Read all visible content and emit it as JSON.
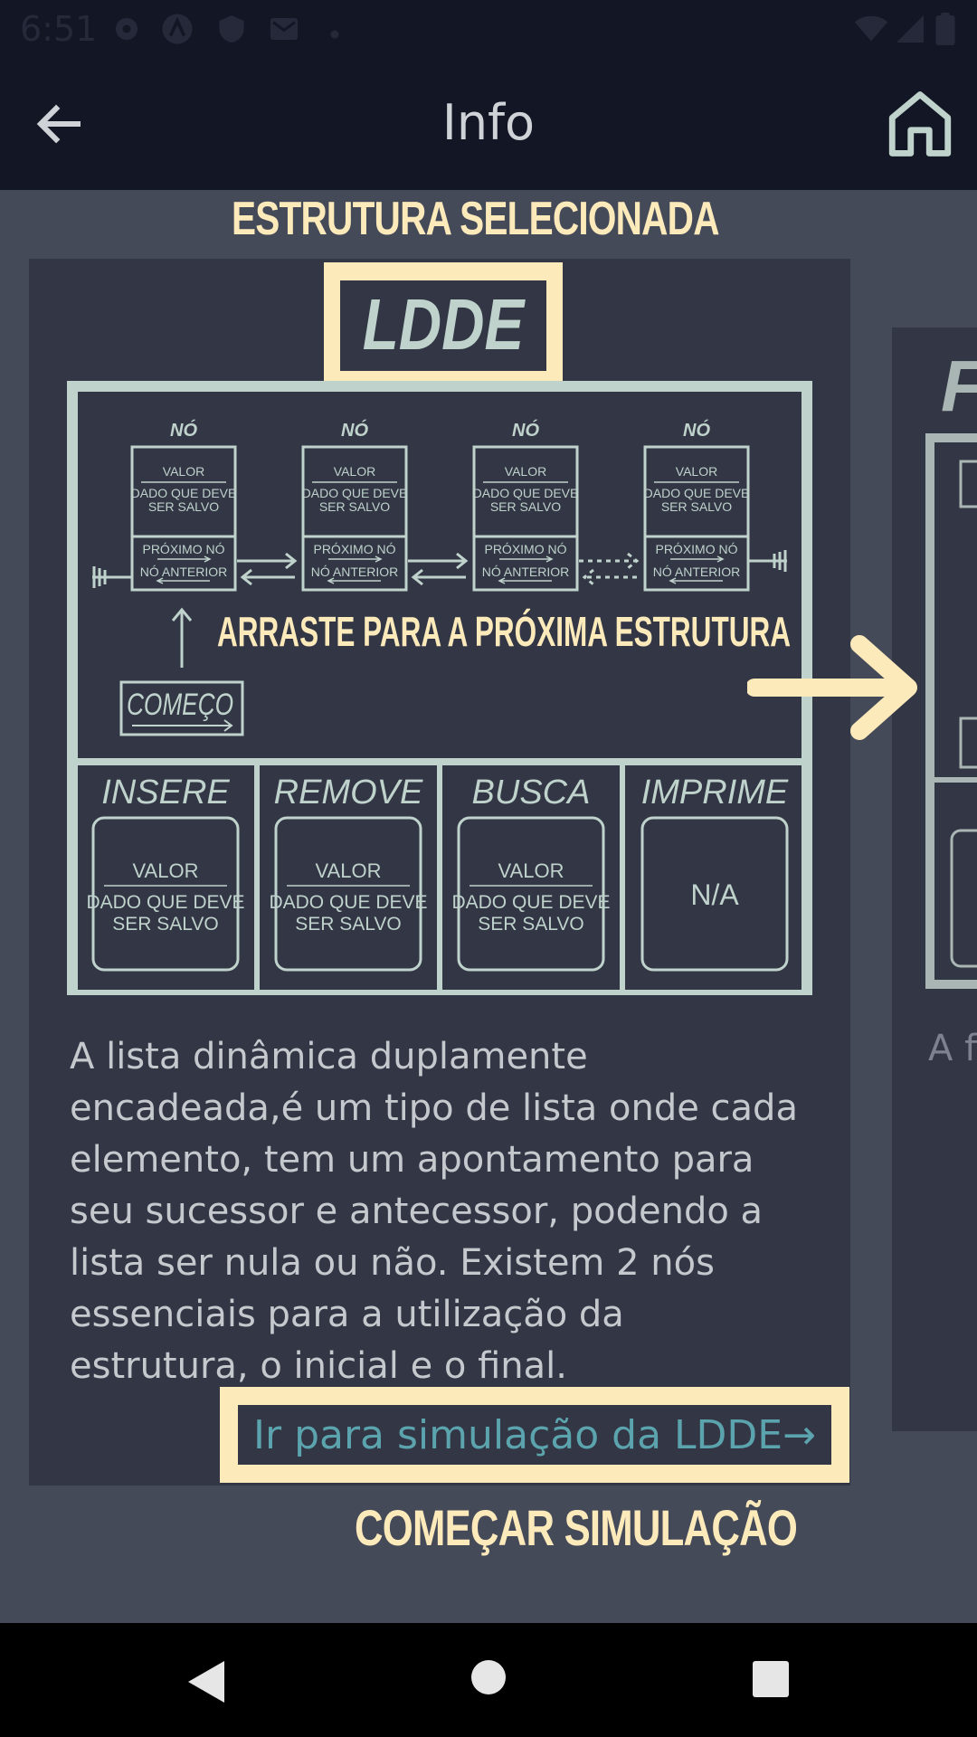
{
  "status_bar": {
    "time": "6:51"
  },
  "app_bar": {
    "title": "Info"
  },
  "selected_caption": "ESTRUTURA SELECIONADA",
  "card": {
    "badge": "LDDE",
    "node_title": "NÓ",
    "node_value_label": "VALOR",
    "node_value_desc_1": "DADO QUE DEVE",
    "node_value_desc_2": "SER SALVO",
    "node_next": "PRÓXIMO NÓ",
    "node_prev": "NÓ ANTERIOR",
    "start_label": "COMEÇO",
    "swipe_hint": "ARRASTE PARA A PRÓXIMA ESTRUTURA",
    "operations": [
      {
        "name": "INSERE",
        "value": "VALOR",
        "desc_1": "DADO QUE DEVE",
        "desc_2": "SER SALVO"
      },
      {
        "name": "REMOVE",
        "value": "VALOR",
        "desc_1": "DADO QUE DEVE",
        "desc_2": "SER SALVO"
      },
      {
        "name": "BUSCA",
        "value": "VALOR",
        "desc_1": "DADO QUE DEVE",
        "desc_2": "SER SALVO"
      },
      {
        "name": "IMPRIME",
        "value": "N/A"
      }
    ],
    "description": "A lista dinâmica duplamente encadeada,é um tipo de lista onde cada elemento, tem um apontamento para seu sucessor e antecessor, podendo a lista ser nula ou não. Existem 2 nós essenciais para a utilização da estrutura, o inicial e o final.",
    "simulation_button": "Ir para simulação da LDDE→"
  },
  "next_card": {
    "badge_partial": "F",
    "description_partial": "A fi line do iníc con"
  },
  "start_simulation_caption": "COMEÇAR SIMULAÇÃO",
  "colors": {
    "accent": "#fceabb",
    "card": "#323645",
    "background": "#454a59",
    "bars": "#131725",
    "link": "#5ba3ad",
    "diagram_line": "#bfd2cb"
  },
  "icons": [
    "gear-icon",
    "a-icon",
    "shield-icon",
    "mail-icon",
    "wifi-icon",
    "signal-icon",
    "battery-icon",
    "back-arrow-icon",
    "home-icon",
    "nav-back-icon",
    "nav-home-icon",
    "nav-recents-icon"
  ]
}
